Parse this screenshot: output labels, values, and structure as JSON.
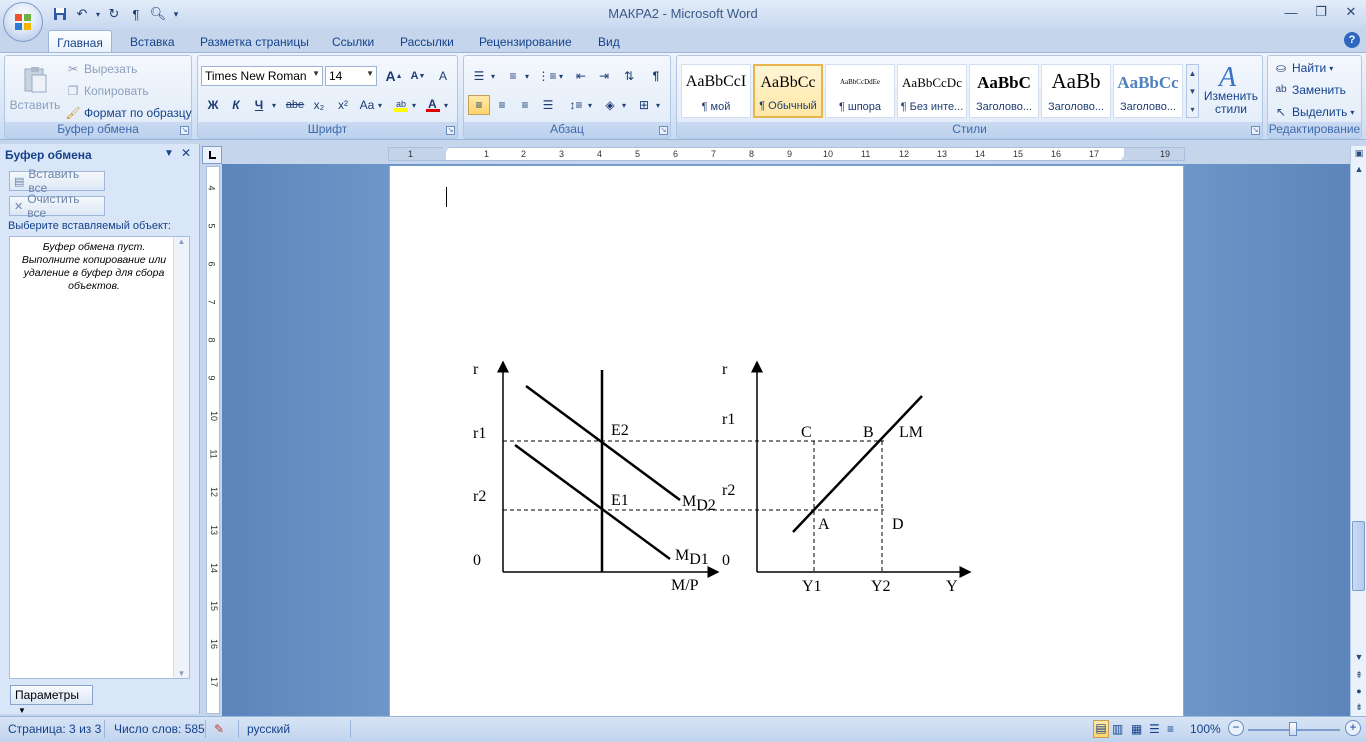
{
  "window": {
    "title": "МАКРА2 - Microsoft Word"
  },
  "tabs": [
    {
      "label": "Главная",
      "active": true
    },
    {
      "label": "Вставка"
    },
    {
      "label": "Разметка страницы"
    },
    {
      "label": "Ссылки"
    },
    {
      "label": "Рассылки"
    },
    {
      "label": "Рецензирование"
    },
    {
      "label": "Вид"
    }
  ],
  "ribbon": {
    "clipboard": {
      "label": "Буфер обмена",
      "paste": "Вставить",
      "cut": "Вырезать",
      "copy": "Копировать",
      "format_painter": "Формат по образцу"
    },
    "font": {
      "label": "Шрифт",
      "font_name": "Times New Roman",
      "font_size": "14",
      "bold": "Ж",
      "italic": "К",
      "underline": "Ч",
      "strike": "abe",
      "subscript": "x₂",
      "superscript": "x²",
      "case": "Aa",
      "grow": "A",
      "shrink": "A"
    },
    "paragraph": {
      "label": "Абзац"
    },
    "styles": {
      "label": "Стили",
      "items": [
        {
          "sample": "AaBbCcI",
          "name": "¶ мой"
        },
        {
          "sample": "AaBbCc",
          "name": "¶ Обычный",
          "selected": true
        },
        {
          "sample": "AaBbCcDdEe",
          "name": "¶ шпора"
        },
        {
          "sample": "AaBbCcDc",
          "name": "¶ Без инте..."
        },
        {
          "sample": "AaBbC",
          "name": "Заголово..."
        },
        {
          "sample": "AaBb",
          "name": "Заголово..."
        },
        {
          "sample": "AaBbCc",
          "name": "Заголово..."
        }
      ],
      "change_styles": "Изменить стили"
    },
    "editing": {
      "label": "Редактирование",
      "find": "Найти",
      "replace": "Заменить",
      "select": "Выделить"
    }
  },
  "clipboard_pane": {
    "title": "Буфер обмена",
    "paste_all": "Вставить все",
    "clear_all": "Очистить все",
    "prompt": "Выберите вставляемый объект:",
    "empty_message": "Буфер обмена пуст. Выполните копирование или удаление в буфер для сбора объектов.",
    "options": "Параметры"
  },
  "ruler": {
    "h_numbers": [
      "1",
      "1",
      "2",
      "3",
      "4",
      "5",
      "6",
      "7",
      "8",
      "9",
      "10",
      "11",
      "12",
      "13",
      "14",
      "15",
      "16",
      "17",
      "19"
    ],
    "v_numbers": [
      "4",
      "5",
      "6",
      "7",
      "8",
      "9",
      "10",
      "11",
      "12",
      "13",
      "14",
      "15",
      "16",
      "17"
    ]
  },
  "chart_data": {
    "type": "diagram",
    "left_panel": {
      "y_axis_label": "r",
      "x_axis_label": "M/P",
      "y_ticks": [
        "r1",
        "r2",
        "0"
      ],
      "points": [
        "E2",
        "E1"
      ],
      "curves": [
        {
          "name": "M",
          "sub": "D2"
        },
        {
          "name": "M",
          "sub": "D1"
        }
      ]
    },
    "right_panel": {
      "y_axis_label": "r",
      "x_axis_label": "Y",
      "y_ticks": [
        "r1",
        "r2",
        "0"
      ],
      "x_ticks": [
        "Y1",
        "Y2"
      ],
      "points": [
        "C",
        "B",
        "A",
        "D"
      ],
      "curve_label": "LM"
    }
  },
  "status": {
    "page": "Страница: 3 из 3",
    "words": "Число слов: 585",
    "language": "русский",
    "zoom": "100%"
  },
  "colors": {
    "accent": "#15428b",
    "ribbon_bg": "#dfeaf8",
    "doc_bg": "#6f96c8",
    "selected_style": "#ffe7a5"
  }
}
